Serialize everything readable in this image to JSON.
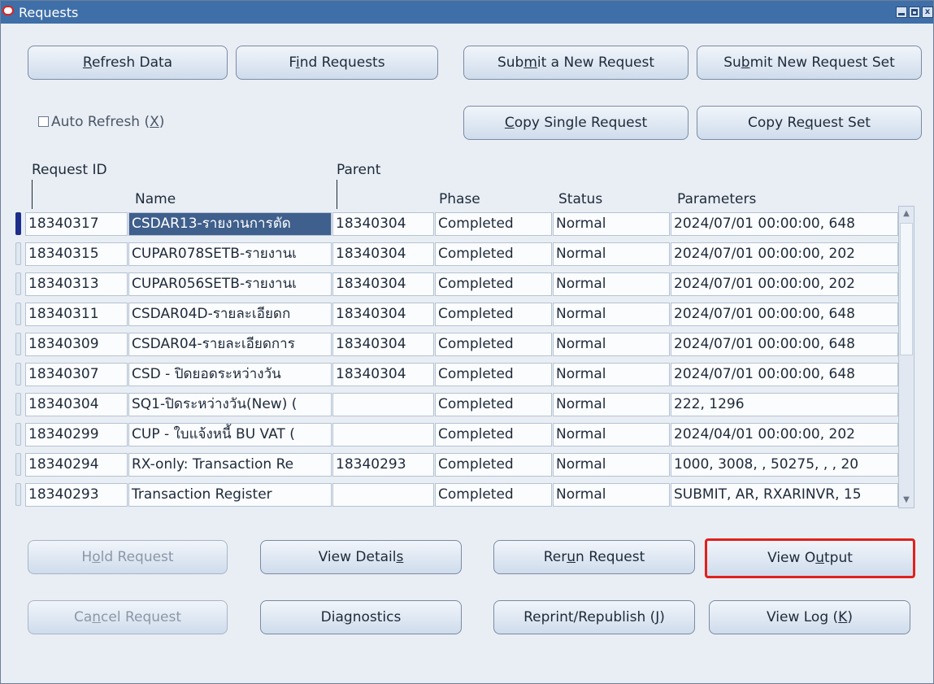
{
  "window": {
    "title": "Requests"
  },
  "top_buttons": {
    "refresh_pre": "",
    "refresh_acc": "R",
    "refresh_post": "efresh Data",
    "find_pre": "F",
    "find_acc": "i",
    "find_post": "nd Requests",
    "submit_pre": "Sub",
    "submit_acc": "m",
    "submit_post": "it a New Request",
    "submit_set_pre": "Su",
    "submit_set_acc": "b",
    "submit_set_post": "mit New Request Set",
    "copy_single_pre": "",
    "copy_single_acc": "C",
    "copy_single_post": "opy Single Request",
    "copy_set_pre": "Copy Re",
    "copy_set_acc": "q",
    "copy_set_post": "uest Set"
  },
  "auto_refresh": {
    "pre": "Auto Refresh (",
    "acc": "X",
    "post": ")",
    "checked": false
  },
  "columns": {
    "request_id": "Request ID",
    "parent": "Parent",
    "name": "Name",
    "phase": "Phase",
    "status": "Status",
    "parameters": "Parameters"
  },
  "rows": [
    {
      "id": "18340317",
      "name": "CSDAR13-รายงานการตัด",
      "parent": "18340304",
      "phase": "Completed",
      "status": "Normal",
      "params": "2024/07/01 00:00:00, 648"
    },
    {
      "id": "18340315",
      "name": "CUPAR078SETB-รายงานเ",
      "parent": "18340304",
      "phase": "Completed",
      "status": "Normal",
      "params": "2024/07/01 00:00:00, 202"
    },
    {
      "id": "18340313",
      "name": "CUPAR056SETB-รายงานเ",
      "parent": "18340304",
      "phase": "Completed",
      "status": "Normal",
      "params": "2024/07/01 00:00:00, 202"
    },
    {
      "id": "18340311",
      "name": "CSDAR04D-รายละเอียดก",
      "parent": "18340304",
      "phase": "Completed",
      "status": "Normal",
      "params": "2024/07/01 00:00:00, 648"
    },
    {
      "id": "18340309",
      "name": "CSDAR04-รายละเอียดการ",
      "parent": "18340304",
      "phase": "Completed",
      "status": "Normal",
      "params": "2024/07/01 00:00:00, 648"
    },
    {
      "id": "18340307",
      "name": "CSD - ปิดยอดระหว่างวัน",
      "parent": "18340304",
      "phase": "Completed",
      "status": "Normal",
      "params": "2024/07/01 00:00:00, 648"
    },
    {
      "id": "18340304",
      "name": "SQ1-ปิดระหว่างวัน(New) (",
      "parent": "",
      "phase": "Completed",
      "status": "Normal",
      "params": "222, 1296"
    },
    {
      "id": "18340299",
      "name": "CUP - ใบแจ้งหนี้ BU VAT (",
      "parent": "",
      "phase": "Completed",
      "status": "Normal",
      "params": "2024/04/01 00:00:00, 202"
    },
    {
      "id": "18340294",
      "name": "RX-only: Transaction Re",
      "parent": "18340293",
      "phase": "Completed",
      "status": "Normal",
      "params": "1000, 3008, , 50275, , , 20"
    },
    {
      "id": "18340293",
      "name": "Transaction Register",
      "parent": "",
      "phase": "Completed",
      "status": "Normal",
      "params": "SUBMIT, AR, RXARINVR, 15"
    }
  ],
  "bottom_buttons": {
    "hold_pre": "H",
    "hold_acc": "o",
    "hold_post": "ld Request",
    "details_pre": "View Detail",
    "details_acc": "s",
    "details_post": "",
    "rerun_pre": "Rer",
    "rerun_acc": "u",
    "rerun_post": "n Request",
    "output_pre": "View O",
    "output_acc": "u",
    "output_post": "tput",
    "cancel_pre": "Ca",
    "cancel_acc": "n",
    "cancel_post": "cel Request",
    "diag_pre": "Dia",
    "diag_acc": "g",
    "diag_post": "nostics",
    "reprint_pre": "Reprint/Republish (",
    "reprint_acc": "J",
    "reprint_post": ")",
    "log_pre": "View Log (",
    "log_acc": "K",
    "log_post": ")"
  },
  "colors": {
    "title_bar": "#3f6fa8",
    "focus": "#e0211d",
    "current_row": "#1c2e8a",
    "selected_cell": "#3f5f8c"
  }
}
